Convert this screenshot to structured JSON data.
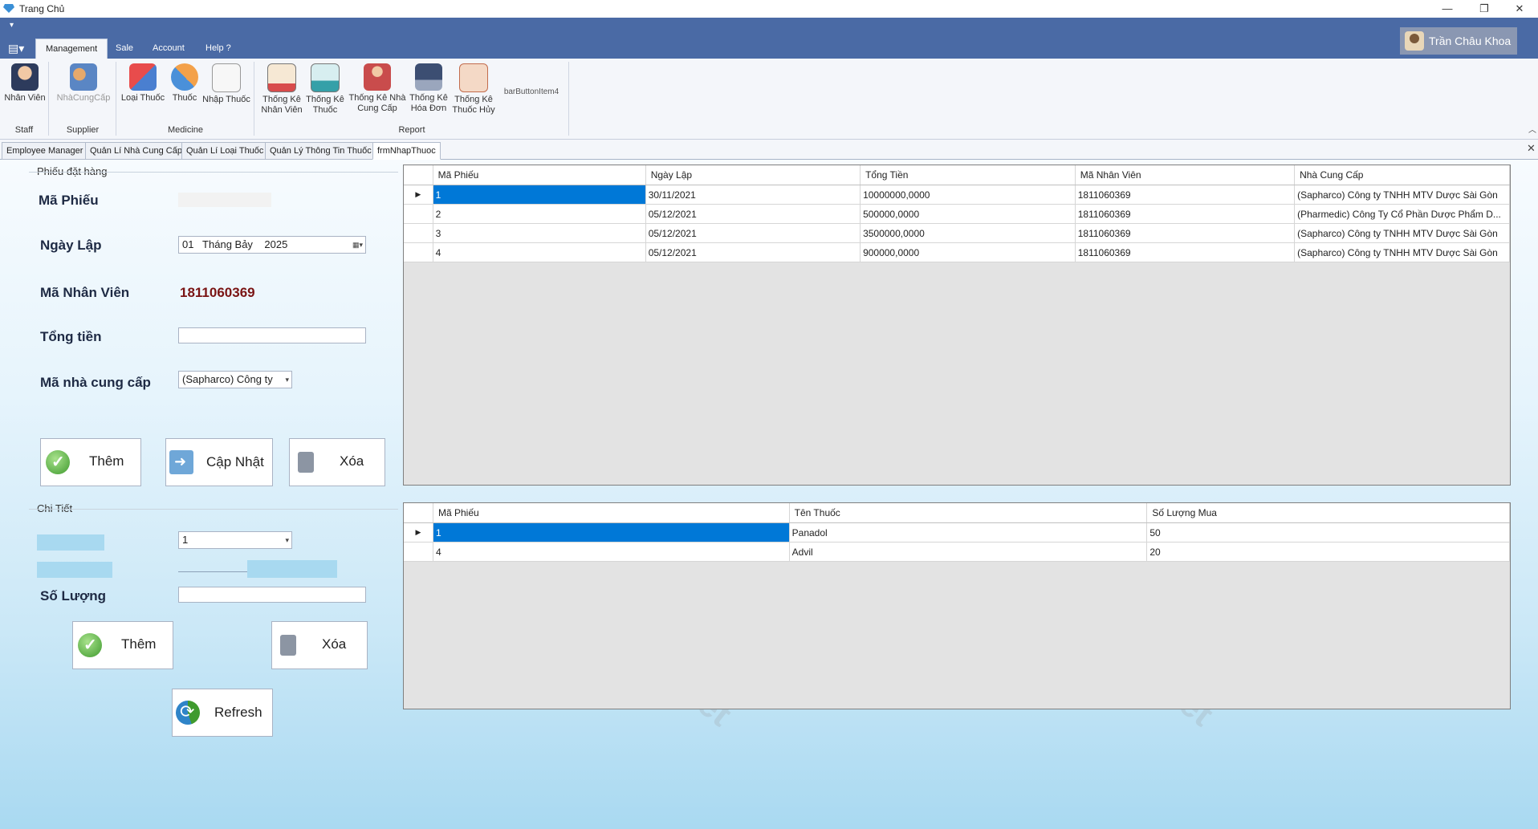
{
  "window": {
    "title": "Trang Chủ",
    "controls": [
      "—",
      "❐",
      "✕"
    ]
  },
  "ribbon": {
    "tabs": [
      "Management",
      "Sale",
      "Account",
      "Help ?"
    ],
    "active_tab": "Management",
    "user": "Trần Châu Khoa",
    "buttons": [
      {
        "label": "Nhân Viên",
        "icon": "employee-icon"
      },
      {
        "label": "NhàCungCấp",
        "icon": "supplier-icon"
      },
      {
        "label": "Loại Thuốc",
        "icon": "medicine-type-icon"
      },
      {
        "label": "Thuốc",
        "icon": "pills-icon"
      },
      {
        "label": "Nhập Thuốc",
        "icon": "import-medicine-icon"
      },
      {
        "label": "Thống Kê\nNhân Viên",
        "icon": "employee-stats-icon"
      },
      {
        "label": "Thống Kê\nThuốc",
        "icon": "medicine-stats-icon"
      },
      {
        "label": "Thống Kê Nhà\nCung Cấp",
        "icon": "supplier-stats-icon"
      },
      {
        "label": "Thống Kê\nHóa Đơn",
        "icon": "invoice-stats-icon"
      },
      {
        "label": "Thống Kê\nThuốc Hủy",
        "icon": "cancelled-medicine-stats-icon"
      },
      {
        "label": "barButtonItem4",
        "icon": ""
      }
    ],
    "groups": [
      "Staff",
      "Supplier",
      "Medicine",
      "Report"
    ]
  },
  "doc_tabs": [
    "Employee Manager",
    "Quản Lí Nhà Cung Cấp",
    "Quản Lí Loại Thuốc",
    "Quản Lý Thông Tin Thuốc",
    "frmNhapThuoc"
  ],
  "active_doc_tab": "frmNhapThuoc",
  "order_form": {
    "group_title": "Phiếu đặt hàng",
    "ma_phieu_label": "Mã Phiếu",
    "ngay_lap_label": "Ngày Lập",
    "ngay_lap_value": "01   Tháng Bảy    2025",
    "ma_nhan_vien_label": "Mã Nhân Viên",
    "ma_nhan_vien_value": "1811060369",
    "tong_tien_label": "Tổng tiền",
    "ma_ncc_label": "Mã nhà cung cấp",
    "ma_ncc_value": "(Sapharco) Công ty",
    "btn_them": "Thêm",
    "btn_cap_nhat": "Cập Nhật",
    "btn_xoa": "Xóa"
  },
  "detail_form": {
    "group_title": "Chi Tiết",
    "phieu_value": "1",
    "so_luong_label": "Số Lượng",
    "btn_them": "Thêm",
    "btn_xoa": "Xóa",
    "btn_refresh": "Refresh"
  },
  "orders_table": {
    "columns": [
      "Mã Phiếu",
      "Ngày Lập",
      "Tổng Tiền",
      "Mã Nhân Viên",
      "Nhà Cung Cấp"
    ],
    "rows": [
      [
        "1",
        "30/11/2021",
        "10000000,0000",
        "1811060369",
        "(Sapharco) Công ty TNHH MTV Dược Sài Gòn"
      ],
      [
        "2",
        "05/12/2021",
        "500000,0000",
        "1811060369",
        "(Pharmedic) Công Ty Cổ Phần Dược Phẩm D..."
      ],
      [
        "3",
        "05/12/2021",
        "3500000,0000",
        "1811060369",
        "(Sapharco) Công ty TNHH MTV Dược Sài Gòn"
      ],
      [
        "4",
        "05/12/2021",
        "900000,0000",
        "1811060369",
        "(Sapharco) Công ty TNHH MTV Dược Sài Gòn"
      ]
    ]
  },
  "details_table": {
    "columns": [
      "Mã Phiếu",
      "Tên Thuốc",
      "Số Lượng Mua"
    ],
    "rows": [
      [
        "1",
        "Panadol",
        "50"
      ],
      [
        "4",
        "Advil",
        "20"
      ]
    ]
  },
  "watermark": "DoAnIT.net"
}
